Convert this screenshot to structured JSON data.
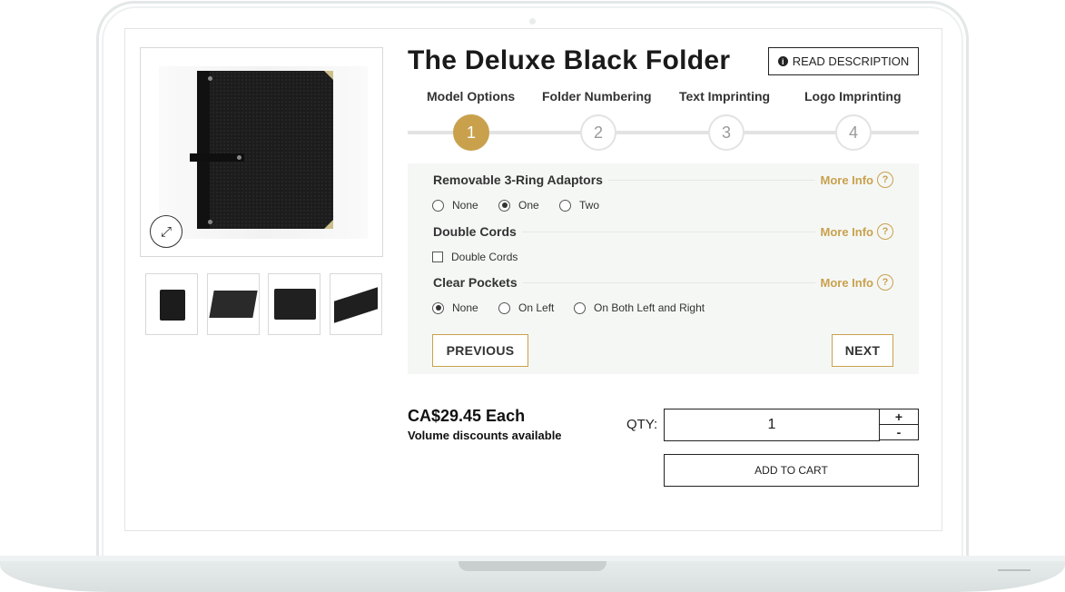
{
  "product": {
    "title": "The Deluxe Black Folder",
    "read_description": "READ DESCRIPTION"
  },
  "steps": [
    {
      "label": "Model Options",
      "number": "1",
      "active": true
    },
    {
      "label": "Folder Numbering",
      "number": "2",
      "active": false
    },
    {
      "label": "Text Imprinting",
      "number": "3",
      "active": false
    },
    {
      "label": "Logo Imprinting",
      "number": "4",
      "active": false
    }
  ],
  "options": {
    "more_info": "More Info",
    "help_glyph": "?",
    "ring_adaptors": {
      "title": "Removable 3-Ring Adaptors",
      "choices": [
        "None",
        "One",
        "Two"
      ],
      "selected": "One"
    },
    "double_cords": {
      "title": "Double Cords",
      "checkbox_label": "Double Cords",
      "checked": false
    },
    "clear_pockets": {
      "title": "Clear Pockets",
      "choices": [
        "None",
        "On Left",
        "On Both Left and Right"
      ],
      "selected": "None"
    }
  },
  "nav": {
    "previous": "PREVIOUS",
    "next": "NEXT"
  },
  "pricing": {
    "price": "CA$29.45 Each",
    "volume_note": "Volume discounts available"
  },
  "cart": {
    "qty_label": "QTY:",
    "qty_value": "1",
    "plus": "+",
    "minus": "-",
    "add_to_cart": "ADD TO CART"
  },
  "icons": {
    "expand": "expand-icon",
    "info": "info-icon",
    "help": "question-circle-icon"
  },
  "colors": {
    "accent": "#c9a14d",
    "panel_bg": "#f5f7f5"
  }
}
